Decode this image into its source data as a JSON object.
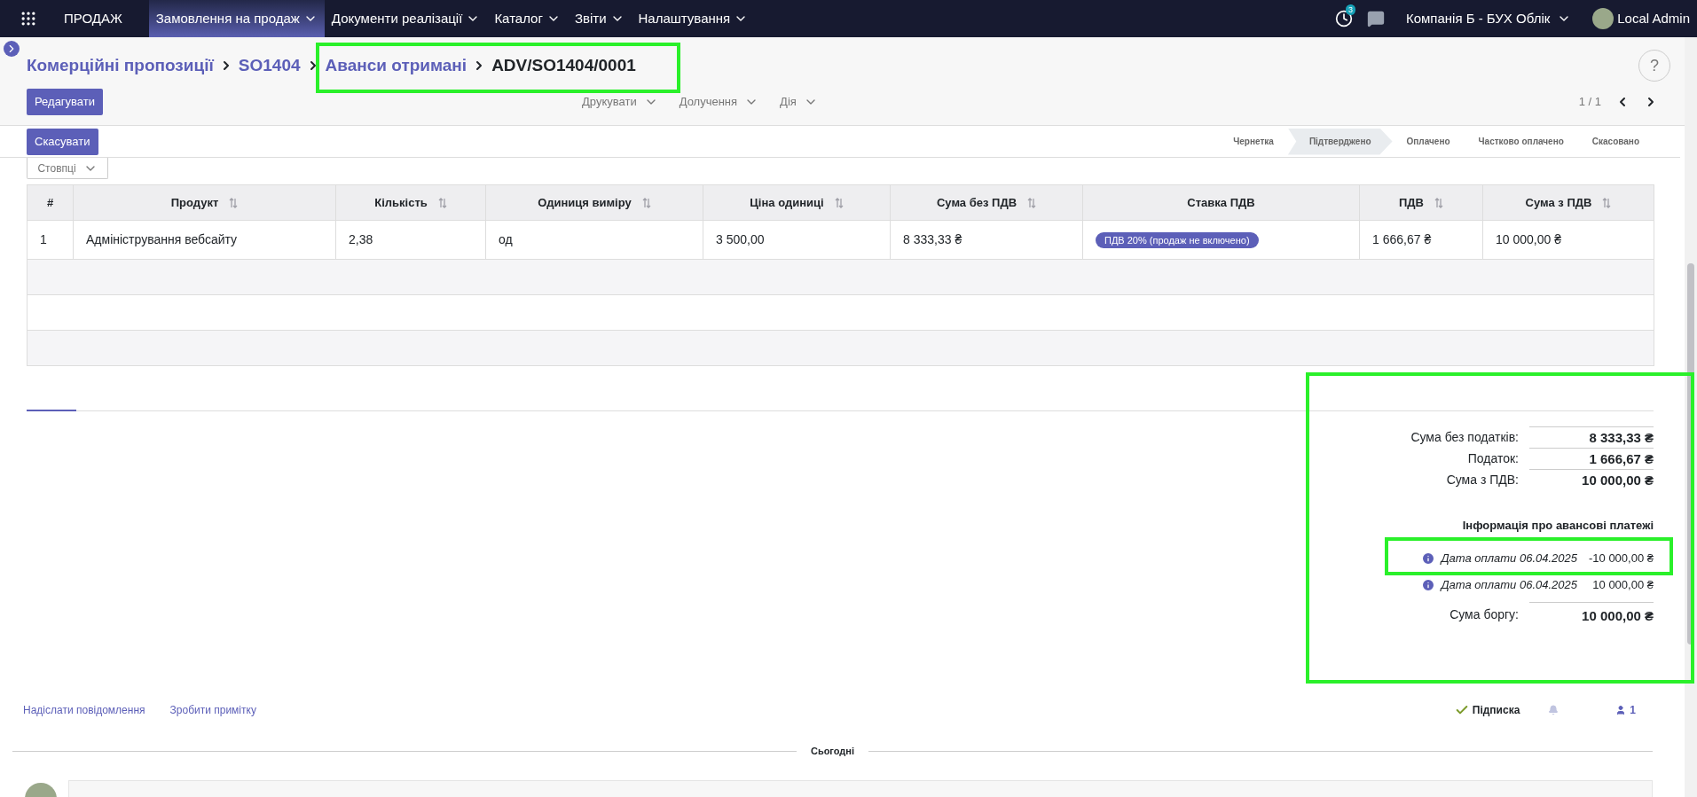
{
  "navbar": {
    "app": "ПРОДАЖ",
    "menus": [
      {
        "label": "Замовлення на продаж",
        "selected": true
      },
      {
        "label": "Документи реалізації",
        "selected": false
      },
      {
        "label": "Каталог",
        "selected": false
      },
      {
        "label": "Звіти",
        "selected": false
      },
      {
        "label": "Налаштування",
        "selected": false
      }
    ],
    "activity_count": "3",
    "company": "Компанія Б - БУХ Облік",
    "user": "Local Admin"
  },
  "breadcrumbs": [
    {
      "label": "Комерційні пропозиції",
      "kind": "link"
    },
    {
      "label": "SO1404",
      "kind": "link"
    },
    {
      "label": "Аванси отримані",
      "kind": "link"
    },
    {
      "label": "ADV/SO1404/0001",
      "kind": "current"
    }
  ],
  "help": "?",
  "edit_button": "Редагувати",
  "actions": [
    "Друкувати",
    "Долучення",
    "Дія"
  ],
  "pager": "1 / 1",
  "cancel_button": "Скасувати",
  "stages": [
    {
      "label": "Чернетка",
      "selected": false
    },
    {
      "label": "Підтверджено",
      "selected": true
    },
    {
      "label": "Оплачено",
      "selected": false
    },
    {
      "label": "Частково оплачено",
      "selected": false
    },
    {
      "label": "Скасовано",
      "selected": false
    }
  ],
  "columns_button": "Стовпці",
  "table": {
    "columns": [
      {
        "label": "#",
        "sortable": false
      },
      {
        "label": "Продукт",
        "sortable": true
      },
      {
        "label": "Кількість",
        "sortable": true
      },
      {
        "label": "Одиниця виміру",
        "sortable": true
      },
      {
        "label": "Ціна одиниці",
        "sortable": true
      },
      {
        "label": "Сума без ПДВ",
        "sortable": true
      },
      {
        "label": "Ставка ПДВ",
        "sortable": false
      },
      {
        "label": "ПДВ",
        "sortable": true
      },
      {
        "label": "Сума з ПДВ",
        "sortable": true
      }
    ],
    "rows": [
      [
        "1",
        "Адміністрування вебсайту",
        "2,38",
        "од",
        "3 500,00",
        "8 333,33 ₴",
        "ПДВ 20% (продаж не включено)",
        "1 666,67 ₴",
        "10 000,00 ₴"
      ]
    ]
  },
  "totals": [
    {
      "label": "Сума без податків:",
      "value": "8 333,33 ₴"
    },
    {
      "label": "Податок:",
      "value": "1 666,67 ₴"
    },
    {
      "label": "Сума з ПДВ:",
      "value": "10 000,00 ₴"
    }
  ],
  "advance_title": "Інформація про авансові платежі",
  "advances": [
    {
      "label": "Дата оплати 06.04.2025",
      "value": "-10 000,00 ₴"
    },
    {
      "label": "Дата оплати 06.04.2025",
      "value": "10 000,00 ₴"
    }
  ],
  "debt": {
    "label": "Сума боргу:",
    "value": "10 000,00 ₴"
  },
  "chatter": {
    "links": [
      "Надіслати повідомлення",
      "Зробити примітку"
    ],
    "follow": "Підписка",
    "followers": "1",
    "date_separator": "Сьогодні"
  }
}
